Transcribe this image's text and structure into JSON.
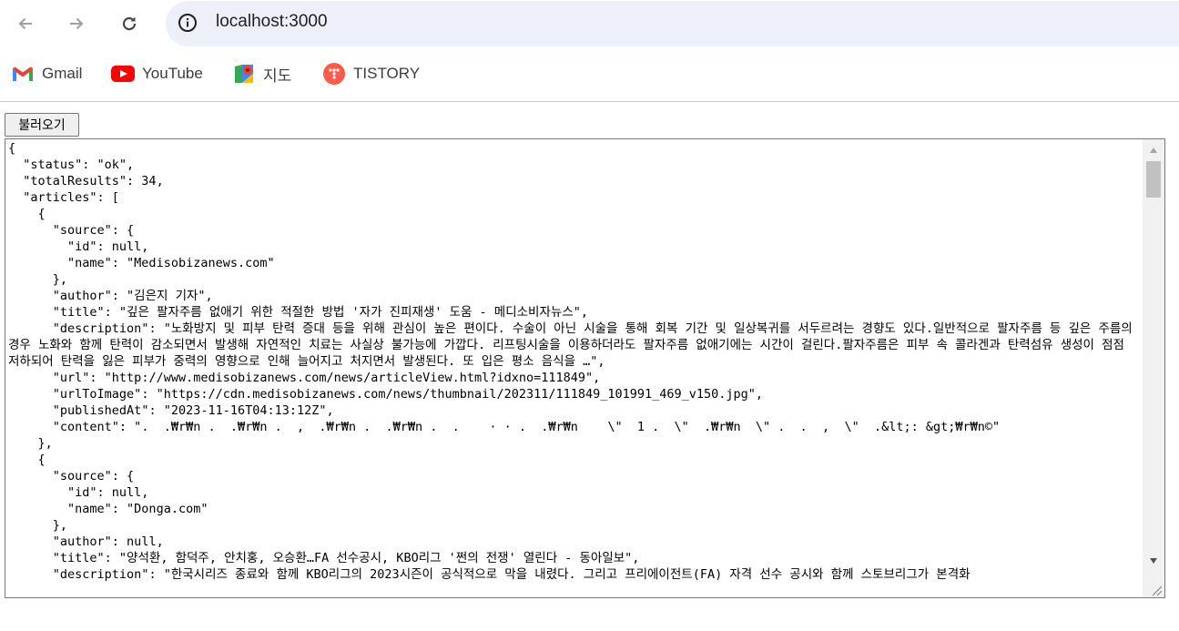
{
  "browser": {
    "url": "localhost:3000",
    "bookmarks": [
      {
        "label": "Gmail",
        "icon": "gmail-icon"
      },
      {
        "label": "YouTube",
        "icon": "youtube-icon"
      },
      {
        "label": "지도",
        "icon": "maps-icon"
      },
      {
        "label": "TISTORY",
        "icon": "tistory-icon"
      }
    ]
  },
  "page": {
    "load_button_label": "불러오기",
    "output_text": "{\n  \"status\": \"ok\",\n  \"totalResults\": 34,\n  \"articles\": [\n    {\n      \"source\": {\n        \"id\": null,\n        \"name\": \"Medisobizanews.com\"\n      },\n      \"author\": \"김은지 기자\",\n      \"title\": \"깊은 팔자주름 없애기 위한 적절한 방법 '자가 진피재생' 도움 - 메디소비자뉴스\",\n      \"description\": \"노화방지 및 피부 탄력 증대 등을 위해 관심이 높은 편이다. 수술이 아닌 시술을 통해 회복 기간 및 일상복귀를 서두르려는 경향도 있다.일반적으로 팔자주름 등 깊은 주름의 경우 노화와 함께 탄력이 감소되면서 발생해 자연적인 치료는 사실상 불가능에 가깝다. 리프팅시술을 이용하더라도 팔자주름 없애기에는 시간이 걸린다.팔자주름은 피부 속 콜라겐과 탄력섬유 생성이 점점 저하되어 탄력을 잃은 피부가 중력의 영향으로 인해 늘어지고 처지면서 발생된다. 또 입은 평소 음식을 …\",\n      \"url\": \"http://www.medisobizanews.com/news/articleView.html?idxno=111849\",\n      \"urlToImage\": \"https://cdn.medisobizanews.com/news/thumbnail/202311/111849_101991_469_v150.jpg\",\n      \"publishedAt\": \"2023-11-16T04:13:12Z\",\n      \"content\": \".  .₩r₩n .  .₩r₩n .  ,  .₩r₩n .  .₩r₩n .  .    · · .  .₩r₩n    \\\"  1 .  \\\"  .₩r₩n  \\\" .  .  ,  \\\"  .&lt;: &gt;₩r₩n©\"\n    },\n    {\n      \"source\": {\n        \"id\": null,\n        \"name\": \"Donga.com\"\n      },\n      \"author\": null,\n      \"title\": \"양석환, 함덕주, 안치홍, 오승환…FA 선수공시, KBO리그 '쩐의 전쟁' 열린다 - 동아일보\",\n      \"description\": \"한국시리즈 종료와 함께 KBO리그의 2023시즌이 공식적으로 막을 내렸다. 그리고 프리에이전트(FA) 자격 선수 공시와 함께 스토브리그가 본격화"
  },
  "colors": {
    "omnibox_bg": "#edf0f9",
    "button_bg": "#efefef",
    "scrollbar_thumb": "#c1c1c1"
  }
}
